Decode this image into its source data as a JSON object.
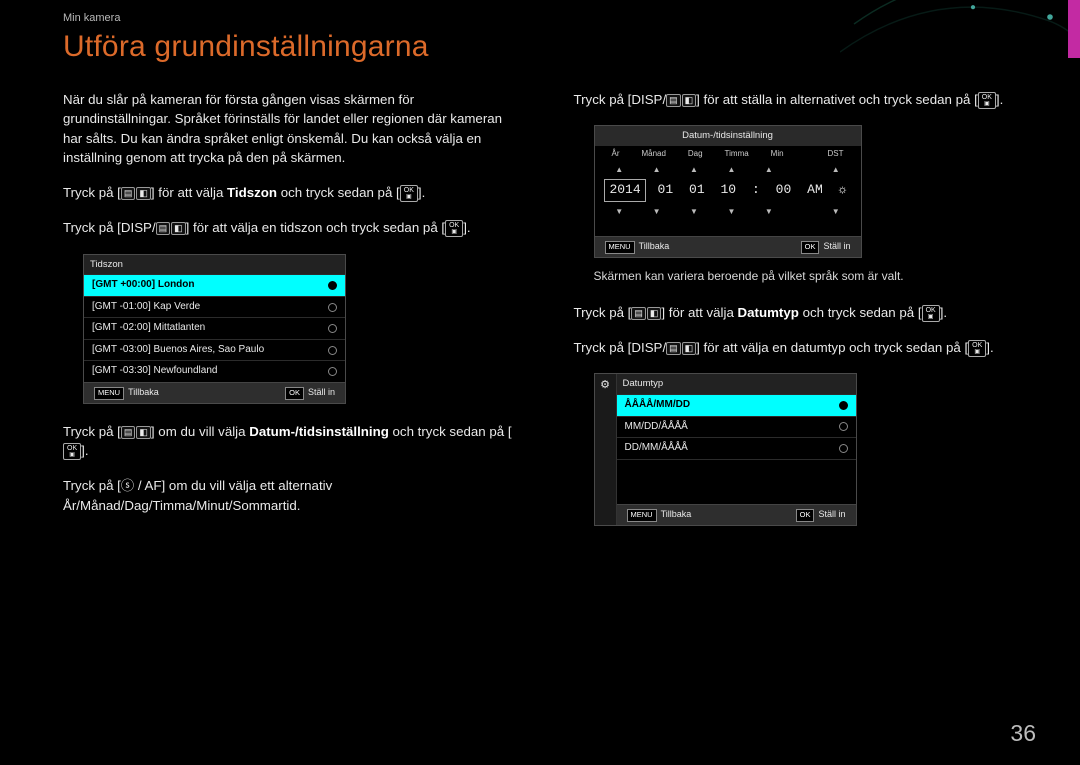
{
  "header": {
    "breadcrumb": "Min kamera",
    "title": "Utföra grundinställningarna"
  },
  "left": {
    "intro": "När du slår på kameran för första gången visas skärmen för grundinställningar. Språket förinställs för landet eller regionen där kameran har sålts. Du kan ändra språket enligt önskemål. Du kan också välja en inställning genom att trycka på den på skärmen.",
    "step1_a": "Tryck på [",
    "step1_b": "] för att välja ",
    "step1_bold": "Tidszon",
    "step1_c": " och tryck sedan på [",
    "step1_d": "].",
    "step2_a": "Tryck på [",
    "step2_disp": "DISP",
    "step2_b": "] för att välja en tidszon och tryck sedan på [",
    "step2_c": "].",
    "tz_panel": {
      "title": "Tidszon",
      "rows": [
        {
          "label": "[GMT +00:00] London",
          "sel": true
        },
        {
          "label": "[GMT -01:00] Kap Verde",
          "sel": false
        },
        {
          "label": "[GMT -02:00] Mittatlanten",
          "sel": false
        },
        {
          "label": "[GMT -03:00] Buenos Aires, Sao Paulo",
          "sel": false
        },
        {
          "label": "[GMT -03:30] Newfoundland",
          "sel": false
        }
      ],
      "menu": "MENU",
      "back": "Tillbaka",
      "ok": "OK",
      "set": "Ställ in"
    },
    "step3_a": "Tryck på [",
    "step3_b": "] om du vill välja ",
    "step3_bold": "Datum-/tidsinställning",
    "step3_c": " och tryck sedan på [",
    "step3_d": "].",
    "step4_a": "Tryck på [",
    "step4_b": "] om du vill välja ett alternativ År/Månad/Dag/Timma/Minut/Sommartid."
  },
  "right": {
    "step5_a": "Tryck på [",
    "step5_disp": "DISP",
    "step5_b": "] för att ställa in alternativet och tryck sedan på [",
    "step5_c": "].",
    "dt_panel": {
      "title": "Datum-/tidsinställning",
      "labels": [
        "År",
        "Månad",
        "Dag",
        "Timma",
        "Min",
        "",
        "DST"
      ],
      "values": [
        "2014",
        "01",
        "01",
        "10",
        ":",
        "00",
        "AM",
        "☼"
      ],
      "menu": "MENU",
      "back": "Tillbaka",
      "ok": "OK",
      "set": "Ställ in"
    },
    "note": "Skärmen kan variera beroende på vilket språk som är valt.",
    "step6_a": "Tryck på [",
    "step6_b": "] för att välja ",
    "step6_bold": "Datumtyp",
    "step6_c": " och tryck sedan på [",
    "step6_d": "].",
    "step7_a": "Tryck på [",
    "step7_disp": "DISP",
    "step7_b": "] för att välja en datumtyp och tryck sedan på [",
    "step7_c": "].",
    "dtype_panel": {
      "title": "Datumtyp",
      "rows": [
        {
          "label": "ÅÅÅÅ/MM/DD",
          "sel": true
        },
        {
          "label": "MM/DD/ÅÅÅÅ",
          "sel": false
        },
        {
          "label": "DD/MM/ÅÅÅÅ",
          "sel": false
        }
      ],
      "menu": "MENU",
      "back": "Tillbaka",
      "ok": "OK",
      "set": "Ställ in"
    }
  },
  "page": "36"
}
